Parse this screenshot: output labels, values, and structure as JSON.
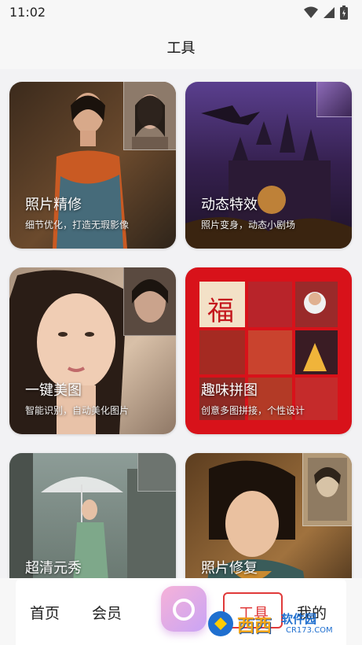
{
  "status": {
    "time": "11:02"
  },
  "header": {
    "title": "工具"
  },
  "cards": [
    {
      "title": "照片精修",
      "subtitle": "细节优化，打造无瑕影像"
    },
    {
      "title": "动态特效",
      "subtitle": "照片变身，动态小剧场"
    },
    {
      "title": "一键美图",
      "subtitle": "智能识别，自动美化图片"
    },
    {
      "title": "趣味拼图",
      "subtitle": "创意多图拼接，个性设计"
    },
    {
      "title": "超清元秀",
      "subtitle": ""
    },
    {
      "title": "照片修复",
      "subtitle": ""
    }
  ],
  "collage": {
    "char": "福"
  },
  "tabs": {
    "home": "首页",
    "vip": "会员",
    "tools": "工具",
    "mine": "我的"
  },
  "watermark": {
    "brand": "西西",
    "site": "软件园",
    "url": "CR173.COM"
  }
}
